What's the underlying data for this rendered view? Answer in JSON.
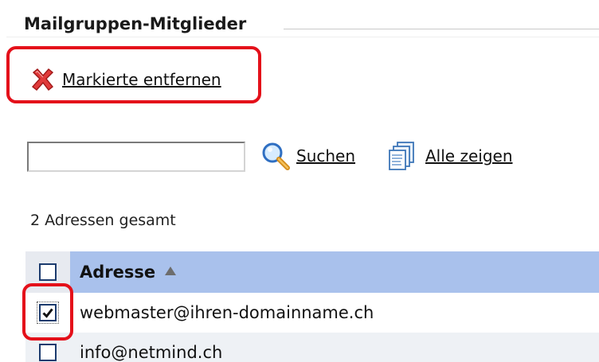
{
  "section": {
    "title": "Mailgruppen-Mitglieder"
  },
  "toolbar": {
    "remove_label": "Markierte entfernen",
    "remove_icon": "red-x-icon"
  },
  "search": {
    "value": "",
    "placeholder": "",
    "search_label": "Suchen",
    "search_icon": "magnifier-icon",
    "show_all_label": "Alle zeigen",
    "show_all_icon": "documents-icon"
  },
  "summary": {
    "count_text": "2 Adressen gesamt"
  },
  "table": {
    "columns": [
      {
        "label": "Adresse",
        "sort": "ascending"
      }
    ],
    "rows": [
      {
        "address": "webmaster@ihren-domainname.ch",
        "checked": true
      },
      {
        "address": "info@netmind.ch",
        "checked": false
      }
    ]
  },
  "colors": {
    "highlight": "#e4101a",
    "header_bg": "#a9c1ec",
    "checkbox_border": "#1c3b6e"
  }
}
